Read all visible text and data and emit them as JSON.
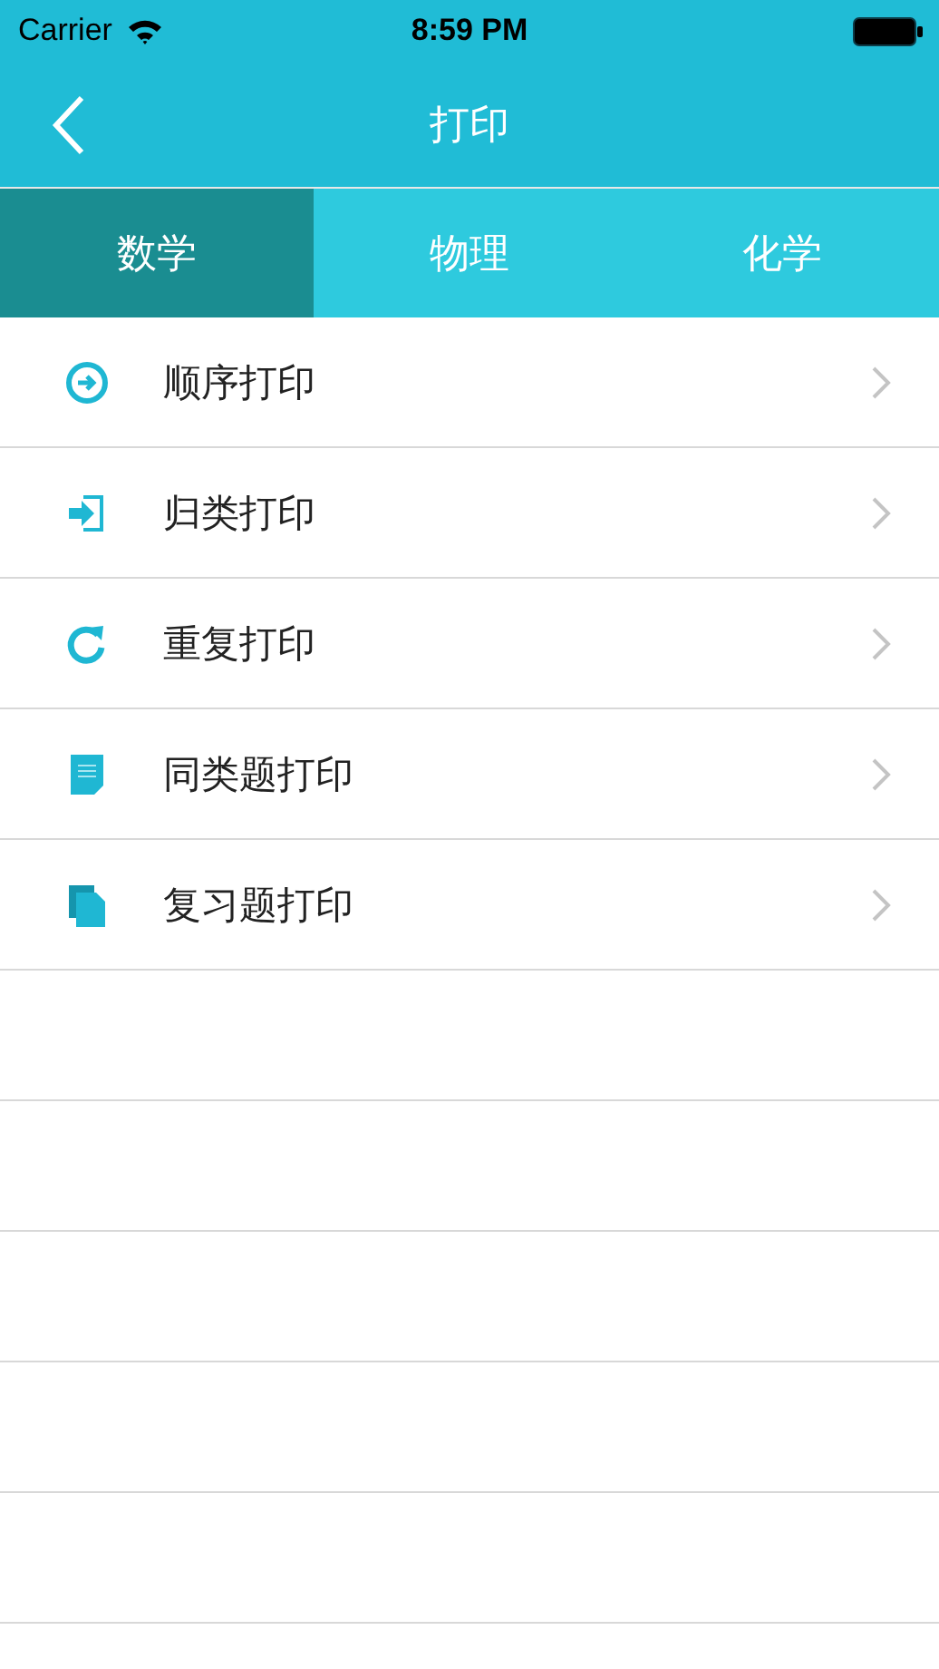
{
  "status_bar": {
    "carrier": "Carrier",
    "time": "8:59 PM"
  },
  "nav": {
    "title": "打印"
  },
  "tabs": [
    {
      "label": "数学",
      "selected": true
    },
    {
      "label": "物理",
      "selected": false
    },
    {
      "label": "化学",
      "selected": false
    }
  ],
  "items": [
    {
      "label": "顺序打印",
      "kind": "sequence"
    },
    {
      "label": "归类打印",
      "kind": "enter"
    },
    {
      "label": "重复打印",
      "kind": "repeat"
    },
    {
      "label": "同类题打印",
      "kind": "note"
    },
    {
      "label": "复习题打印",
      "kind": "copy"
    }
  ]
}
